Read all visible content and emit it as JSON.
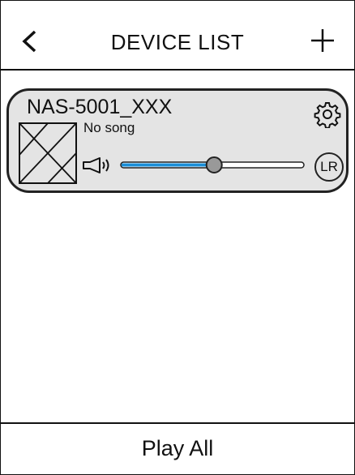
{
  "header": {
    "title": "DEVICE LIST",
    "back_icon": "chevron-left-icon",
    "add_icon": "plus-icon"
  },
  "device": {
    "name": "NAS-5001_XXX",
    "song": "No song",
    "settings_icon": "gear-icon",
    "speaker_icon": "speaker-icon",
    "volume_percent": 51,
    "channel_label": "LR"
  },
  "colors": {
    "accent": "#1a8fd8",
    "card_bg": "#e4e4e4",
    "outline": "#222222"
  },
  "footer": {
    "play_all_label": "Play All"
  }
}
